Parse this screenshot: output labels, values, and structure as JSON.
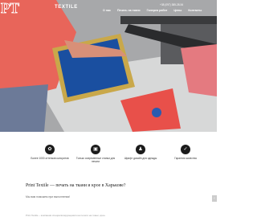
{
  "header": {
    "logo_text": "TEXTILE",
    "phone": "+38 (097) 385-28-54",
    "nav": [
      "О нас",
      "Печать на ткани",
      "Галерея работ",
      "Цены",
      "Контакты"
    ]
  },
  "features": [
    {
      "icon": "thread-icon",
      "label": "Более 1000 оттенков колоритов"
    },
    {
      "icon": "frame-icon",
      "label": "Только современные станки для печати"
    },
    {
      "icon": "tshirt-icon",
      "label": "Шрифт дизайн для одежды"
    },
    {
      "icon": "check-icon",
      "label": "Гарантия качества"
    }
  ],
  "content": {
    "title": "Print Textile — печать на ткани и крое в Харькове?",
    "subtitle": "Мы вам поможем при выполнении!",
    "body": "Print Textile – компания специализирующаяся на печати на ткани, крое."
  },
  "colors": {
    "accent": "#e8655a",
    "blue": "#1a4fa0",
    "frame": "#c9a84a"
  }
}
